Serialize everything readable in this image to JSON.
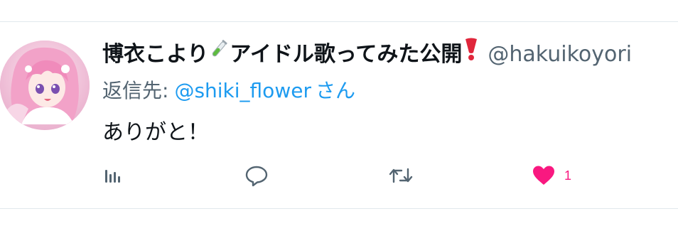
{
  "tweet": {
    "display_name": "博衣こより",
    "display_name_suffix": "アイドル歌ってみた公開",
    "handle": "@hakuikoyori",
    "reply_prefix": "返信先:",
    "reply_user": "@shiki_flower",
    "reply_suffix": "さん",
    "text": "ありがと！"
  },
  "actions": {
    "views_icon": "analytics-icon",
    "reply_icon": "reply-bubble-icon",
    "retweet_icon": "retweet-icon",
    "like_icon": "heart-icon",
    "like_count": "1"
  },
  "colors": {
    "text": "#0f1419",
    "secondary": "#536471",
    "link": "#1d9bf0",
    "like": "#f91880",
    "divider": "#e1e8ed"
  }
}
